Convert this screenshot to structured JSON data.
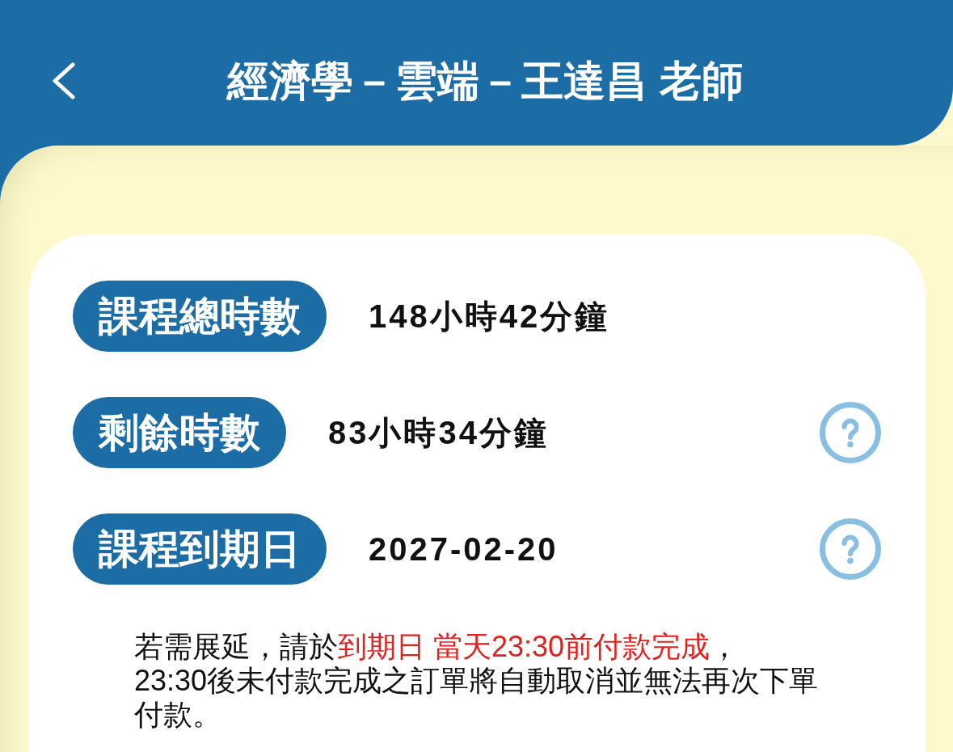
{
  "header": {
    "title": "經濟學－雲端－王達昌 老師"
  },
  "info_rows": [
    {
      "label": "課程總時數",
      "value": "148小時42分鐘",
      "help": false
    },
    {
      "label": "剩餘時數",
      "value": "83小時34分鐘",
      "help": true
    },
    {
      "label": "課程到期日",
      "value": "2027-02-20",
      "help": true
    }
  ],
  "notice": {
    "parts": [
      {
        "text": "若需展延，請於",
        "highlight": false
      },
      {
        "text": "到期日 當天23:30前付款完成",
        "highlight": true
      },
      {
        "text": "，\n23:30後未付款完成之訂單將自動取消並無法再次下單付款。",
        "highlight": false
      }
    ]
  }
}
